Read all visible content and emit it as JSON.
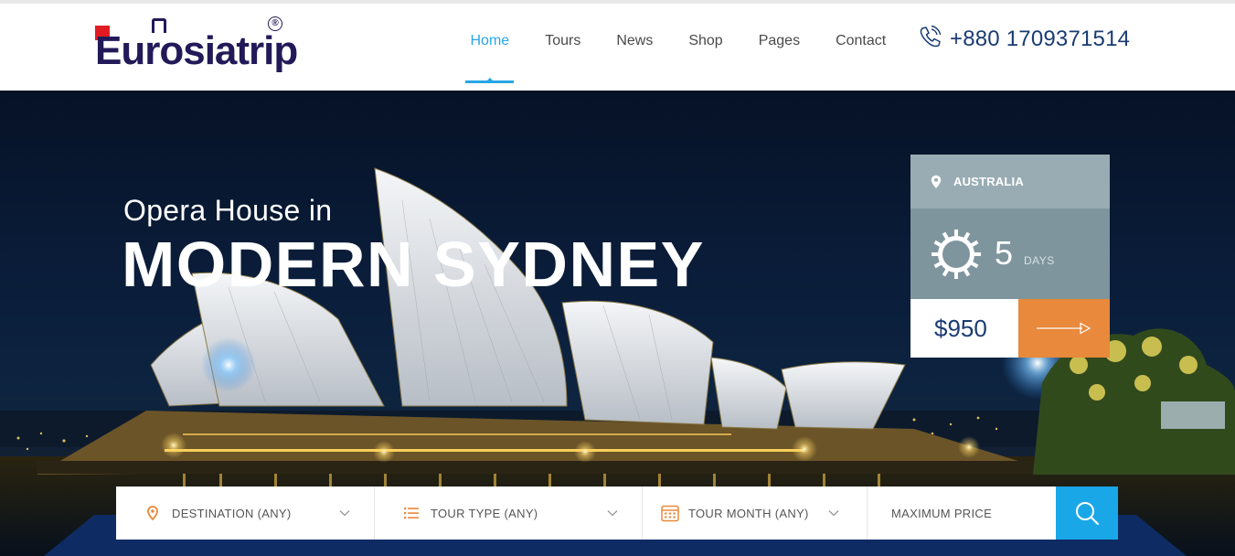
{
  "brand": {
    "logo_text": "Eurosiatrip",
    "registered": "®"
  },
  "nav": {
    "items": [
      {
        "label": "Home",
        "active": true
      },
      {
        "label": "Tours",
        "active": false
      },
      {
        "label": "News",
        "active": false
      },
      {
        "label": "Shop",
        "active": false
      },
      {
        "label": "Pages",
        "active": false
      },
      {
        "label": "Contact",
        "active": false
      }
    ]
  },
  "phone": {
    "icon": "phone-icon",
    "number": "+880 1709371514"
  },
  "hero": {
    "subtitle": "Opera House in",
    "title": "MODERN SYDNEY"
  },
  "tour_card": {
    "location": "AUSTRALIA",
    "duration_value": "5",
    "duration_unit": "DAYS",
    "price": "$950",
    "icons": [
      "map-pin-icon",
      "sun-icon",
      "arrow-right-icon"
    ]
  },
  "search": {
    "destination": "DESTINATION (ANY)",
    "tour_type": "TOUR TYPE (ANY)",
    "tour_month": "TOUR MONTH (ANY)",
    "max_price": "MAXIMUM PRICE",
    "icons": [
      "map-pin-icon",
      "list-icon",
      "calendar-icon",
      "chevron-down-icon",
      "search-icon"
    ]
  },
  "colors": {
    "accent_blue": "#29a6e6",
    "brand_navy": "#221a58",
    "brand_red": "#e21b23",
    "card_orange": "#e8893b",
    "card_grey": "#99acb3",
    "search_button": "#1aa7e8"
  }
}
